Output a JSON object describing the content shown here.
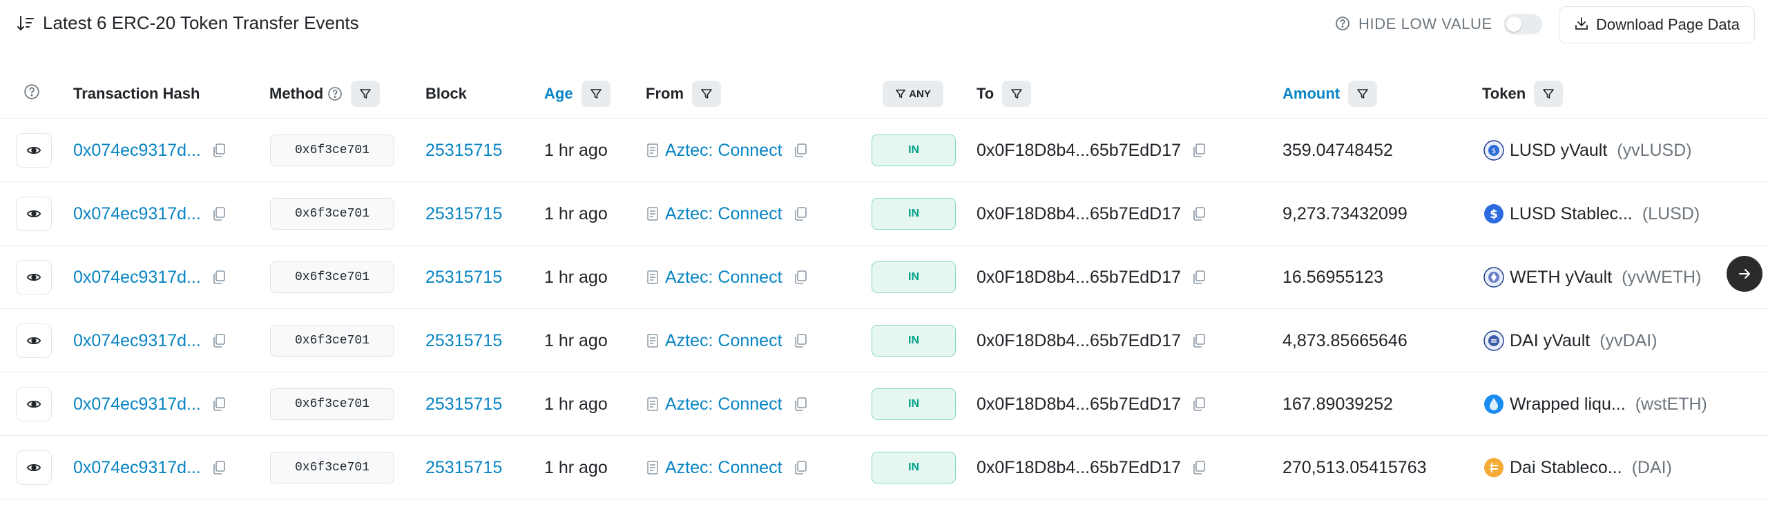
{
  "header": {
    "title": "Latest 6 ERC-20 Token Transfer Events",
    "hide_low_value_label": "HIDE LOW VALUE",
    "hide_low_value_on": false,
    "download_label": "Download Page Data"
  },
  "columns": {
    "transaction_hash": "Transaction Hash",
    "method": "Method",
    "block": "Block",
    "age": "Age",
    "from": "From",
    "direction_filter": "ANY",
    "to": "To",
    "amount": "Amount",
    "token": "Token"
  },
  "rows": [
    {
      "hash": "0x074ec9317d...",
      "method": "0x6f3ce701",
      "block": "25315715",
      "age": "1 hr ago",
      "from": "Aztec: Connect",
      "direction": "IN",
      "to": "0x0F18D8b4...65b7EdD17",
      "amount": "359.04748452",
      "token_name": "LUSD yVault",
      "token_symbol": "(yvLUSD)",
      "token_icon": "yvault-lusd-icon"
    },
    {
      "hash": "0x074ec9317d...",
      "method": "0x6f3ce701",
      "block": "25315715",
      "age": "1 hr ago",
      "from": "Aztec: Connect",
      "direction": "IN",
      "to": "0x0F18D8b4...65b7EdD17",
      "amount": "9,273.73432099",
      "token_name": "LUSD Stablec...",
      "token_symbol": "(LUSD)",
      "token_icon": "lusd-icon"
    },
    {
      "hash": "0x074ec9317d...",
      "method": "0x6f3ce701",
      "block": "25315715",
      "age": "1 hr ago",
      "from": "Aztec: Connect",
      "direction": "IN",
      "to": "0x0F18D8b4...65b7EdD17",
      "amount": "16.56955123",
      "token_name": "WETH yVault",
      "token_symbol": "(yvWETH)",
      "token_icon": "yvault-weth-icon"
    },
    {
      "hash": "0x074ec9317d...",
      "method": "0x6f3ce701",
      "block": "25315715",
      "age": "1 hr ago",
      "from": "Aztec: Connect",
      "direction": "IN",
      "to": "0x0F18D8b4...65b7EdD17",
      "amount": "4,873.85665646",
      "token_name": "DAI yVault",
      "token_symbol": "(yvDAI)",
      "token_icon": "yvault-dai-icon"
    },
    {
      "hash": "0x074ec9317d...",
      "method": "0x6f3ce701",
      "block": "25315715",
      "age": "1 hr ago",
      "from": "Aztec: Connect",
      "direction": "IN",
      "to": "0x0F18D8b4...65b7EdD17",
      "amount": "167.89039252",
      "token_name": "Wrapped liqu...",
      "token_symbol": "(wstETH)",
      "token_icon": "wsteth-icon"
    },
    {
      "hash": "0x074ec9317d...",
      "method": "0x6f3ce701",
      "block": "25315715",
      "age": "1 hr ago",
      "from": "Aztec: Connect",
      "direction": "IN",
      "to": "0x0F18D8b4...65b7EdD17",
      "amount": "270,513.05415763",
      "token_name": "Dai Stableco...",
      "token_symbol": "(DAI)",
      "token_icon": "dai-icon"
    }
  ],
  "colors": {
    "link": "#0784c3",
    "in_badge_bg": "#e6f7f2",
    "in_badge_text": "#00a186",
    "muted": "#6c757d"
  }
}
